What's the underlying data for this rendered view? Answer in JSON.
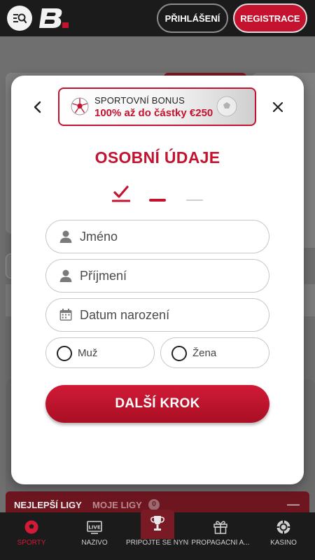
{
  "header": {
    "login_label": "PŘIHLÁŠENÍ",
    "register_label": "REGISTRACE"
  },
  "background": {
    "league_tab_1": "NEJLEPŠÍ LIGY",
    "league_tab_2": "MOJE LIGY",
    "league_tab_2_count": "0"
  },
  "modal": {
    "bonus": {
      "line1": "SPORTOVNÍ BONUS",
      "line2": "100% až do částky €250"
    },
    "title": "OSOBNÍ ÚDAJE",
    "steps": {
      "current": 2,
      "total": 3
    },
    "fields": {
      "first_name_placeholder": "Jméno",
      "last_name_placeholder": "Příjmení",
      "birthdate_placeholder": "Datum narození"
    },
    "gender": {
      "male": "Muž",
      "female": "Žena"
    },
    "next_label": "DALŠÍ KROK"
  },
  "bottom_nav": {
    "items": [
      {
        "label": "SPORTY",
        "icon": "soccer-ball-icon"
      },
      {
        "label": "NAŽIVO",
        "icon": "live-icon"
      },
      {
        "label": "PŘIPOJTE SE NYNÍ",
        "icon": "trophy-icon"
      },
      {
        "label": "PROPAGAČNÍ A...",
        "icon": "gift-icon"
      },
      {
        "label": "KASINO",
        "icon": "casino-chip-icon"
      }
    ]
  },
  "colors": {
    "accent": "#c4122f",
    "header_bg": "#1b1b1b",
    "nav_active": "#d11a36"
  }
}
